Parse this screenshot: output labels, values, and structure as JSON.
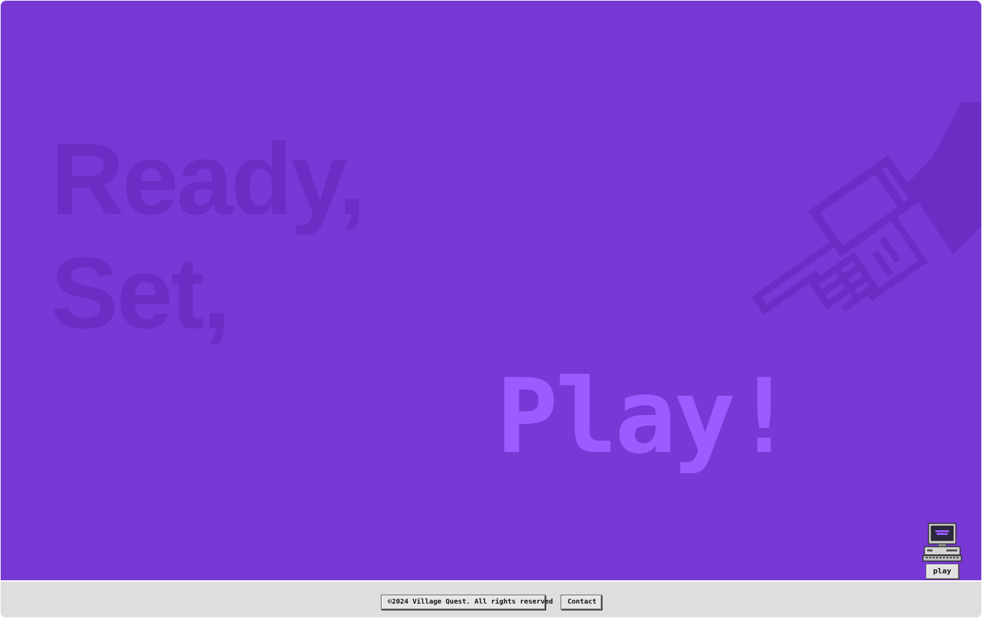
{
  "hero": {
    "tagline_line1": "Ready,",
    "tagline_line2": "Set,",
    "play_word": "Play!",
    "background_color": "#7838d6",
    "tagline_color": "#6a2ec4",
    "play_color": "#9a5cff",
    "hand_icon": "pointing-hand-icon"
  },
  "desktop_shortcut": {
    "icon": "computer-icon",
    "label": "play"
  },
  "footer": {
    "copyright": "©2024 Village Quest. All rights reserved",
    "contact_label": "Contact"
  }
}
